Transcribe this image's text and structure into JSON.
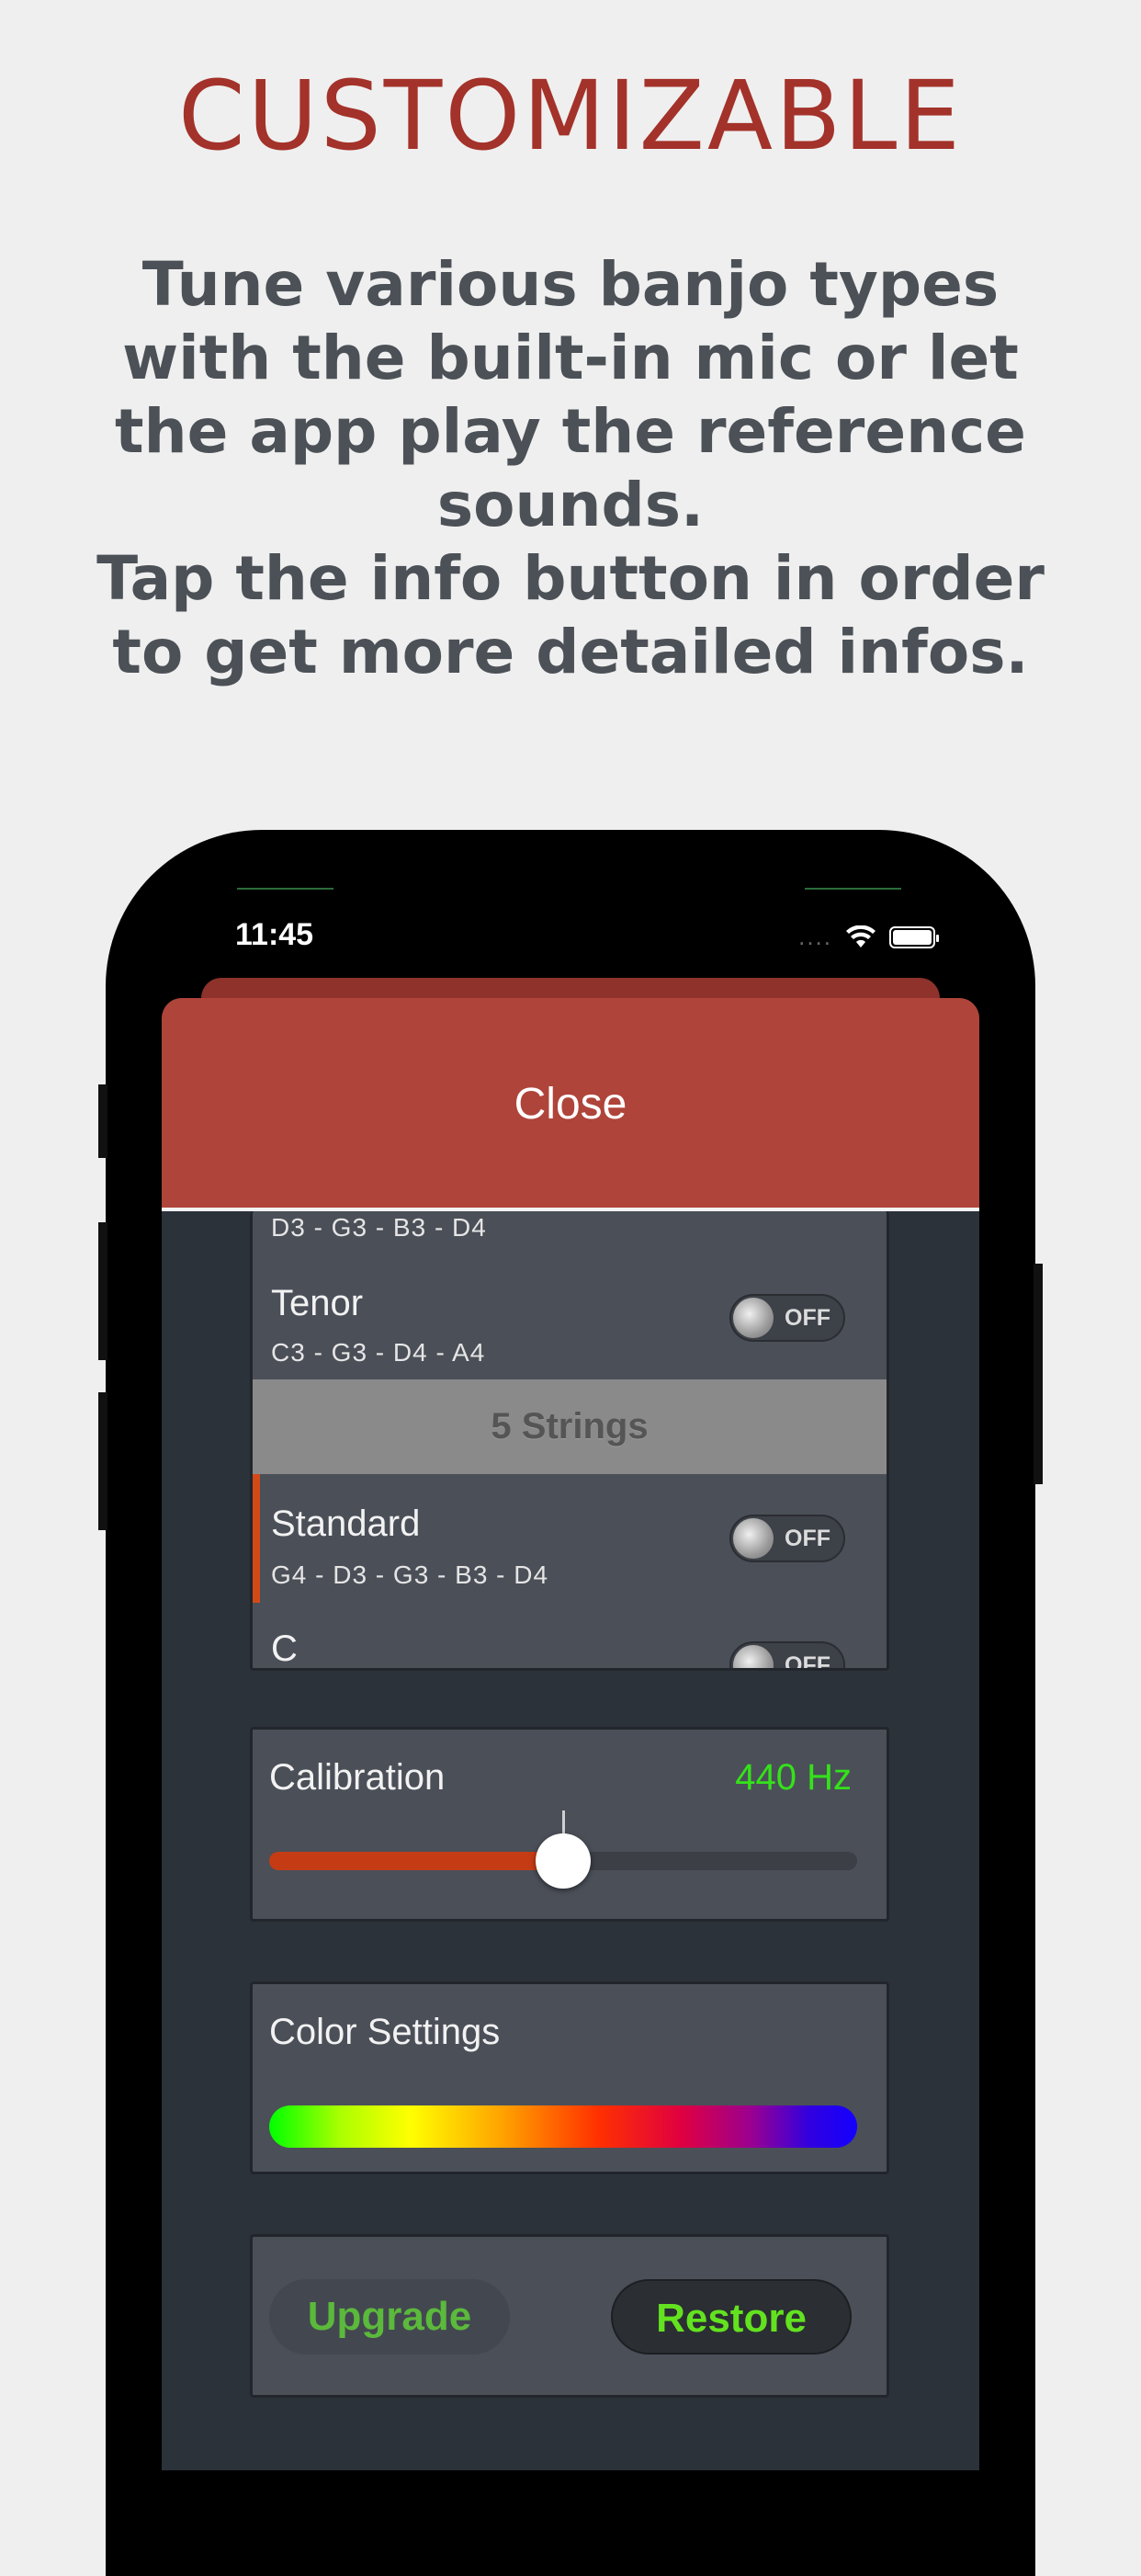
{
  "headline": "CUSTOMIZABLE",
  "description": "Tune various banjo types\nwith the built-in mic or let\nthe app play the reference\nsounds.\nTap the info button in order\nto get more detailed infos.",
  "status_bar": {
    "time": "11:45",
    "signal": "....",
    "icons": [
      "wifi-icon",
      "battery-icon"
    ]
  },
  "sheet": {
    "close_label": "Close",
    "tunings": {
      "partial_row_notes": "D3 - G3 - B3 - D4",
      "tenor": {
        "name": "Tenor",
        "notes": "C3 - G3 - D4 - A4",
        "switch": "OFF"
      },
      "section_header": "5 Strings",
      "standard": {
        "name": "Standard",
        "notes": "G4 - D3 - G3 - B3 - D4",
        "switch": "OFF",
        "selected": true
      },
      "c": {
        "name": "C",
        "switch": "OFF"
      }
    },
    "calibration": {
      "title": "Calibration",
      "value": "440 Hz",
      "slider_fraction": 0.5
    },
    "color_settings": {
      "title": "Color Settings"
    },
    "purchase": {
      "upgrade_label": "Upgrade",
      "restore_label": "Restore"
    }
  },
  "colors": {
    "headline": "#a3322a",
    "header_red": "#af443a",
    "accent_orange": "#d24a16",
    "value_green": "#34e21a"
  }
}
